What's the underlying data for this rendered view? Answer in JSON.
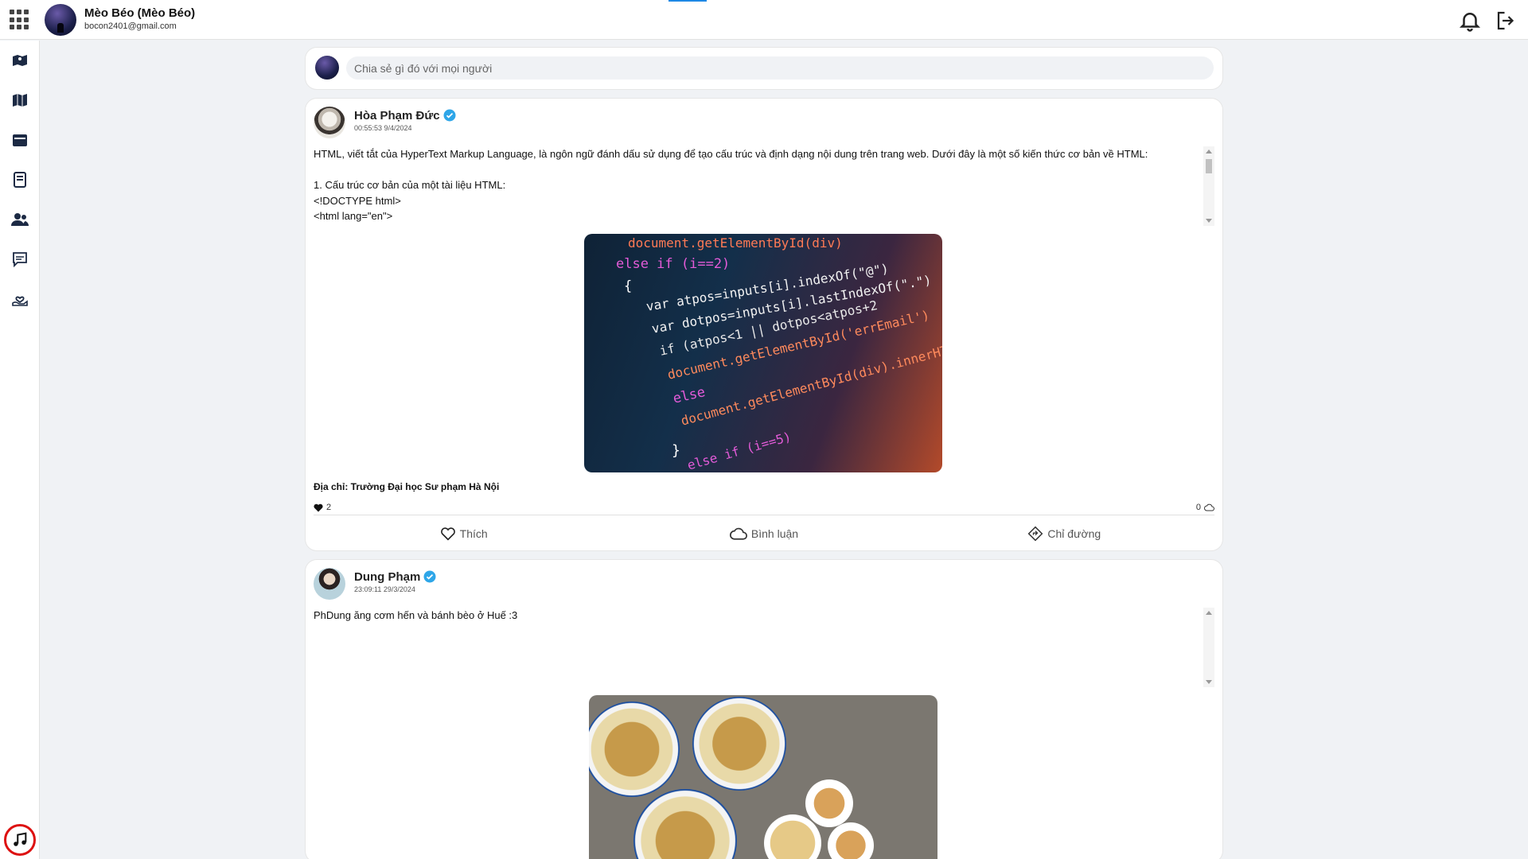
{
  "header": {
    "user_name": "Mèo Béo (Mèo Béo)",
    "user_email": "bocon2401@gmail.com"
  },
  "sidebar": {
    "items": [
      {
        "icon": "map-marker-icon"
      },
      {
        "icon": "map-icon"
      },
      {
        "icon": "calendar-icon"
      },
      {
        "icon": "book-icon"
      },
      {
        "icon": "users-icon"
      },
      {
        "icon": "chat-icon"
      },
      {
        "icon": "hand-heart-icon"
      }
    ],
    "music_icon": "music-icon"
  },
  "composer": {
    "placeholder": "Chia sẻ gì đó với mọi người"
  },
  "posts": [
    {
      "author": "Hòa Phạm Đức",
      "time": "00:55:53 9/4/2024",
      "text_lines": [
        "HTML, viết tắt của HyperText Markup Language, là ngôn ngữ đánh dấu sử dụng để tạo cấu trúc và định dạng nội dung trên trang web. Dưới đây là một số kiến thức cơ bản về HTML:",
        "",
        "1. Cấu trúc cơ bản của một tài liệu HTML:",
        "<!DOCTYPE html>",
        "<html lang=\"en\">"
      ],
      "code_lines": [
        "document.getElementById(div)",
        "else if (i==2)",
        "{",
        "var atpos=inputs[i].indexOf(\"@\")",
        "var dotpos=inputs[i].lastIndexOf(\".\")",
        "if (atpos<1 || dotpos<atpos+2",
        "document.getElementById('errEmail')",
        "else",
        "document.getElementById(div).innerHTML",
        "}",
        "else if (i==5)"
      ],
      "address": "Địa chỉ: Trường Đại học Sư phạm Hà Nội",
      "likes": "2",
      "comments": "0"
    },
    {
      "author": "Dung Phạm",
      "time": "23:09:11 29/3/2024",
      "text_lines": [
        "PhDung ăng cơm hến và bánh bèo ở Huế :3"
      ]
    }
  ],
  "actions": {
    "like": "Thích",
    "comment": "Bình luận",
    "directions": "Chỉ đường"
  },
  "colors": {
    "verified": "#2ea6e8",
    "accent": "#1e88e5",
    "music_ring": "#dd1111"
  }
}
